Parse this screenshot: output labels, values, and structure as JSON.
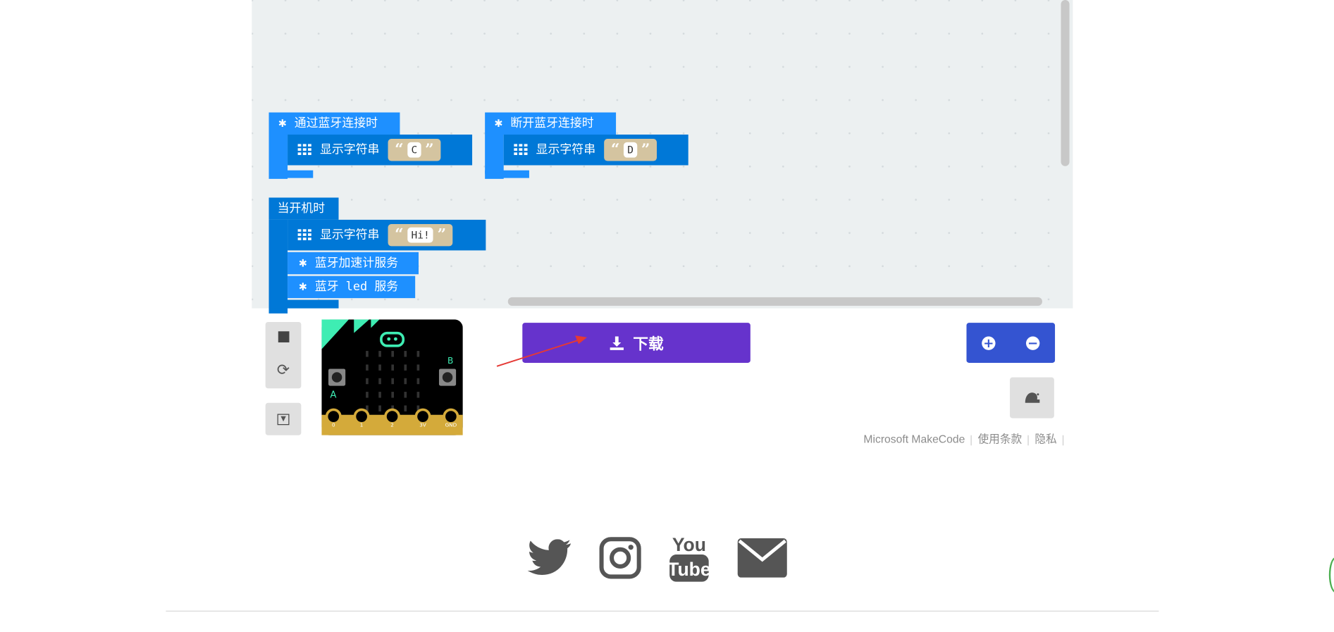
{
  "workspace": {
    "block_connect": {
      "event_label": "通过蓝牙连接时",
      "action_label": "显示字符串",
      "value": "C"
    },
    "block_disconnect": {
      "event_label": "断开蓝牙连接时",
      "action_label": "显示字符串",
      "value": "D"
    },
    "block_start": {
      "event_label": "当开机时",
      "show_label": "显示字符串",
      "show_value": "Hi!",
      "accel_label": "蓝牙加速计服务",
      "led_label": "蓝牙 led 服务"
    }
  },
  "simulator": {
    "pins": [
      "0",
      "1",
      "2",
      "3V",
      "GND"
    ]
  },
  "toolbar": {
    "download_label": "下载"
  },
  "footer": {
    "links": [
      "Microsoft MakeCode",
      "使用条款",
      "隐私"
    ]
  },
  "social": [
    "twitter-icon",
    "instagram-icon",
    "youtube-icon",
    "email-icon"
  ],
  "colors": {
    "block_blue": "#0078d7",
    "block_event": "#1e90ff",
    "string_tan": "#d4c4a0",
    "download_purple": "#6633cc",
    "zoom_blue": "#3454d1",
    "arrow_red": "#e53935"
  }
}
